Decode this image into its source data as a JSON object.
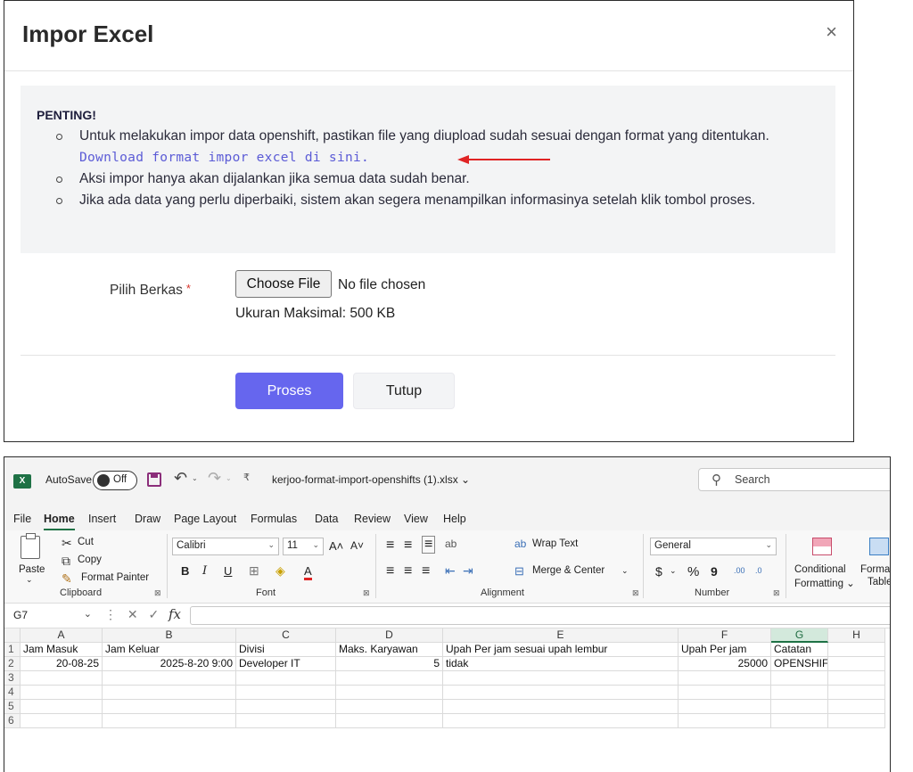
{
  "modal": {
    "title": "Impor Excel",
    "close_icon": "×",
    "notice": {
      "heading": "PENTING!",
      "item1_text": "Untuk melakukan impor data openshift, pastikan file yang diupload sudah sesuai dengan format yang ditentukan. ",
      "item1_link": "Download format impor excel di sini.",
      "item2": "Aksi impor hanya akan dijalankan jika semua data sudah benar.",
      "item3": "Jika ada data yang perlu diperbaiki, sistem akan segera menampilkan informasinya setelah klik tombol proses."
    },
    "file_field": {
      "label": "Pilih Berkas",
      "required_mark": "*",
      "button": "Choose File",
      "status": "No file chosen",
      "hint": "Ukuran Maksimal: 500 KB"
    },
    "buttons": {
      "submit": "Proses",
      "close": "Tutup"
    },
    "colors": {
      "primary": "#6666ee",
      "link": "#5b5bd6",
      "arrow": "#e02424"
    }
  },
  "excel": {
    "logo": "X",
    "autosave_label": "AutoSave",
    "autosave_state": "Off",
    "undo_icon": "↶",
    "redo_icon": "↷",
    "dropdown_glyph": "⌄",
    "customize_glyph": "₹",
    "file_name": "kerjoo-format-import-openshifts (1).xlsx ⌄",
    "search_placeholder": "Search",
    "search_icon": "⚲",
    "menu": [
      "File",
      "Home",
      "Insert",
      "Draw",
      "Page Layout",
      "Formulas",
      "Data",
      "Review",
      "View",
      "Help"
    ],
    "ribbon": {
      "clipboard": {
        "paste": "Paste",
        "cut": "Cut",
        "copy": "Copy",
        "format_painter": "Format Painter",
        "label": "Clipboard"
      },
      "font": {
        "name": "Calibri",
        "size": "11",
        "grow": "A˄",
        "shrink": "A˅",
        "bold": "B",
        "italic": "I",
        "underline": "U",
        "border": "⊞",
        "fill": "◈",
        "color": "A",
        "label": "Font"
      },
      "alignment": {
        "wrap": "Wrap Text",
        "merge": "Merge & Center",
        "align_top": "≡",
        "align_mid": "≡",
        "align_bottom": "≡",
        "orient": "ab",
        "left": "≡",
        "center": "≡",
        "right": "≡",
        "dec_indent": "⇤",
        "inc_indent": "⇥",
        "label": "Alignment"
      },
      "number": {
        "format": "General",
        "currency": "$",
        "percent": "%",
        "comma": "9",
        "inc_dec": ".00",
        "dec_dec": ".0",
        "label": "Number"
      },
      "styles": {
        "conditional": "Conditional",
        "conditional2": "Formatting ⌄",
        "format_table": "Forma",
        "format_table2": "Table"
      },
      "launcher": "⊠"
    },
    "formula_bar": {
      "cell_ref": "G7",
      "cancel": "✕",
      "enter": "✓",
      "fx": "fx",
      "colon": "⋮",
      "value": ""
    },
    "sheet": {
      "columns": [
        "A",
        "B",
        "C",
        "D",
        "E",
        "F",
        "G",
        "H"
      ],
      "selected_column": "G",
      "row_numbers": [
        "1",
        "2",
        "3",
        "4",
        "5",
        "6"
      ],
      "rows": [
        [
          "Jam Masuk",
          "Jam Keluar",
          "Divisi",
          "Maks. Karyawan",
          "Upah Per jam sesuai upah lembur",
          "Upah Per jam",
          "Catatan",
          ""
        ],
        [
          "20-08-25",
          "2025-8-20 9:00",
          "Developer IT",
          "5",
          "tidak",
          "25000",
          "OPENSHIFT",
          ""
        ],
        [
          "",
          "",
          "",
          "",
          "",
          "",
          "",
          ""
        ],
        [
          "",
          "",
          "",
          "",
          "",
          "",
          "",
          ""
        ],
        [
          "",
          "",
          "",
          "",
          "",
          "",
          "",
          ""
        ],
        [
          "",
          "",
          "",
          "",
          "",
          "",
          "",
          ""
        ]
      ]
    }
  }
}
